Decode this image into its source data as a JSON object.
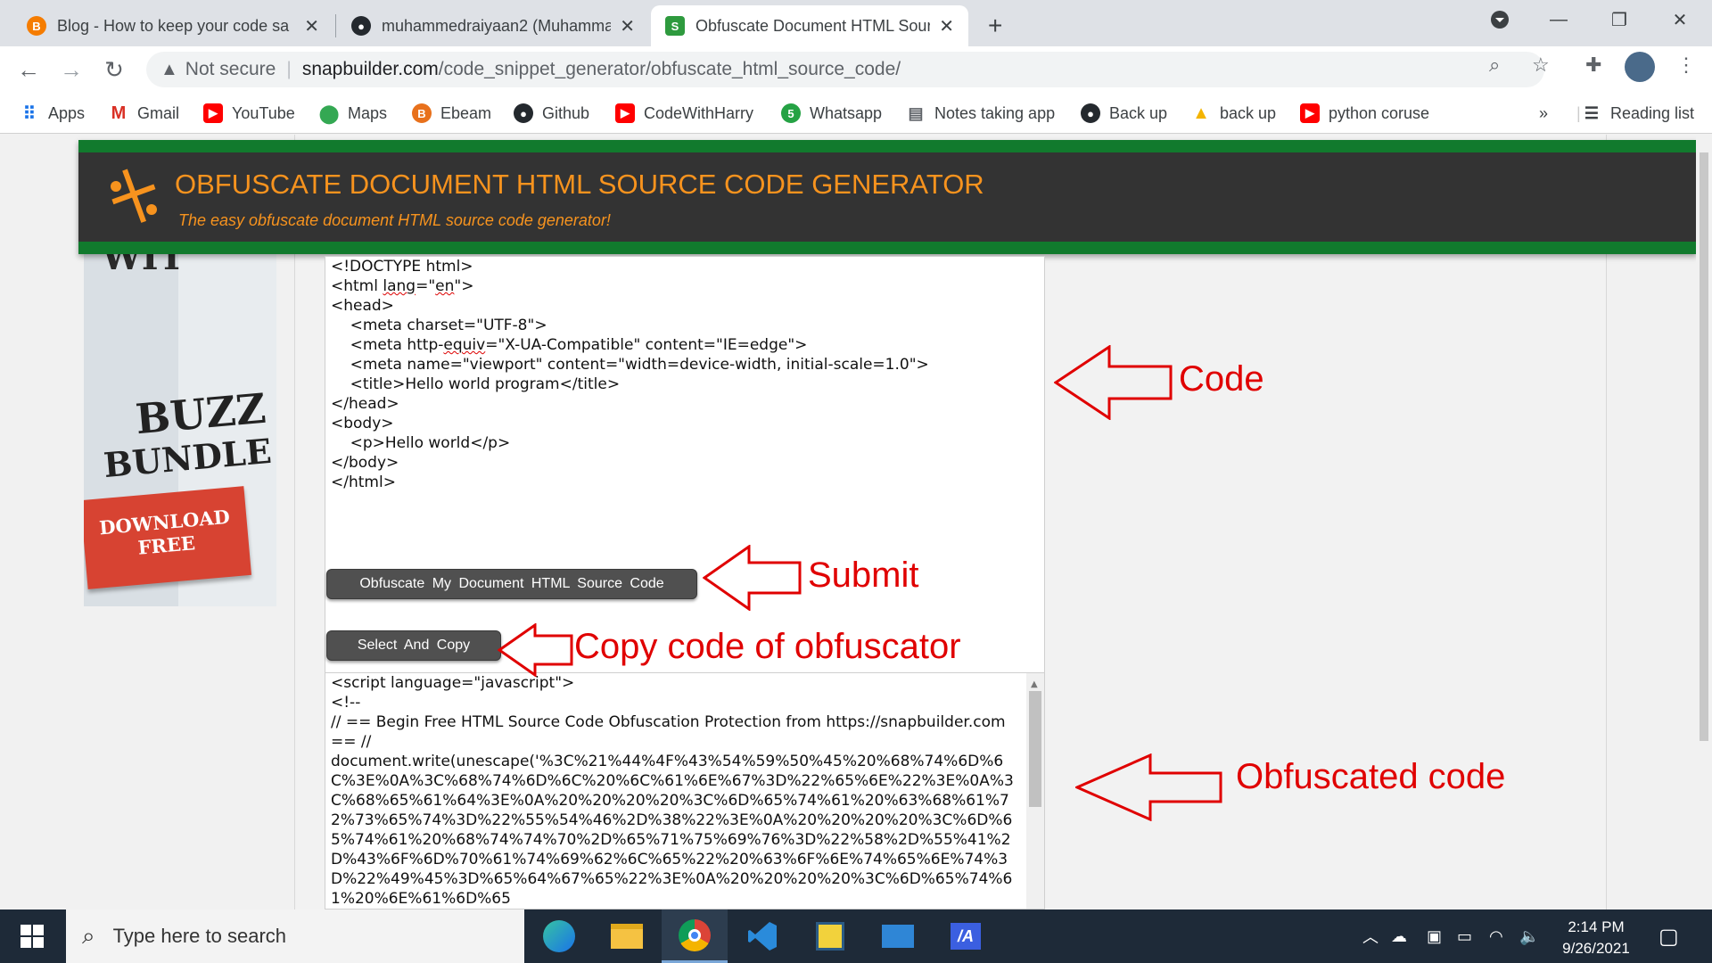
{
  "browser": {
    "tabs": [
      {
        "title": "Blog - How to keep your code sa",
        "favicon": "blogger-icon",
        "active": false
      },
      {
        "title": "muhammedraiyaan2 (Muhamma",
        "favicon": "github-icon",
        "active": false
      },
      {
        "title": "Obfuscate Document HTML Sour",
        "favicon": "snapbuilder-icon",
        "active": true
      }
    ],
    "new_tab_label": "+",
    "address": {
      "security_label": "Not secure",
      "host": "snapbuilder.com",
      "path": "/code_snippet_generator/obfuscate_html_source_code/"
    },
    "bookmarks": [
      {
        "label": "Apps",
        "icon": "apps-grid-icon",
        "color": "#1a73e8"
      },
      {
        "label": "Gmail",
        "icon": "gmail-icon",
        "color": "#d93025"
      },
      {
        "label": "YouTube",
        "icon": "youtube-icon",
        "color": "#ff0000"
      },
      {
        "label": "Maps",
        "icon": "maps-icon",
        "color": "#34a853"
      },
      {
        "label": "Ebeam",
        "icon": "ebeam-icon",
        "color": "#e8711c"
      },
      {
        "label": "Github",
        "icon": "github-icon",
        "color": "#24292e"
      },
      {
        "label": "CodeWithHarry",
        "icon": "youtube-icon",
        "color": "#ff0000"
      },
      {
        "label": "Whatsapp",
        "icon": "whatsapp-icon",
        "color": "#25a244"
      },
      {
        "label": "Notes taking app",
        "icon": "notes-icon",
        "color": "#5f6368"
      },
      {
        "label": "Back up",
        "icon": "github-icon",
        "color": "#24292e"
      },
      {
        "label": "back up",
        "icon": "drive-icon",
        "color": "#f4b400"
      },
      {
        "label": "python coruse",
        "icon": "youtube-icon",
        "color": "#ff0000"
      }
    ],
    "overflow_label": "»",
    "reading_list_label": "Reading list"
  },
  "site": {
    "title": "OBFUSCATE DOCUMENT HTML SOURCE CODE GENERATOR",
    "tagline": "The easy obfuscate document HTML source code generator!",
    "accent": "#f7931e",
    "header_green": "#117a2d"
  },
  "ad": {
    "cut_text": "WIT",
    "line1": "BUZZ",
    "line2": "BUNDLE",
    "cta_line1": "DOWNLOAD",
    "cta_line2": "FREE"
  },
  "input_code": [
    "<!DOCTYPE html>",
    "<html lang=\"en\">",
    "<head>",
    "    <meta charset=\"UTF-8\">",
    "    <meta http-equiv=\"X-UA-Compatible\" content=\"IE=edge\">",
    "    <meta name=\"viewport\" content=\"width=device-width, initial-scale=1.0\">",
    "    <title>Hello world program</title>",
    "</head>",
    "<body>",
    "    <p>Hello world</p>",
    "</body>",
    "</html>"
  ],
  "buttons": {
    "obfuscate": "Obfuscate My Document HTML Source Code",
    "select_copy": "Select And Copy"
  },
  "output_code": [
    "<script language=\"javascript\">",
    "<!--",
    "// == Begin Free HTML Source Code Obfuscation Protection from https://snapbuilder.com == //",
    "document.write(unescape('%3C%21%44%4F%43%54%59%50%45%20%68%74%6D%6C%3E%0A%3C%68%74%6D%6C%20%6C%61%6E%67%3D%22%65%6E%22%3E%0A%3C%68%65%61%64%3E%0A%20%20%20%20%3C%6D%65%74%61%20%63%68%61%72%73%65%74%3D%22%55%54%46%2D%38%22%3E%0A%20%20%20%20%3C%6D%65%74%61%20%68%74%74%70%2D%65%71%75%69%76%3D%22%58%2D%55%41%2D%43%6F%6D%70%61%74%69%62%6C%65%22%20%63%6F%6E%74%65%6E%74%3D%22%49%45%3D%65%64%67%65%22%3E%0A%20%20%20%20%3C%6D%65%74%61%20%6E%61%6D%65"
  ],
  "annotations": {
    "code": "Code",
    "submit": "Submit",
    "copy": "Copy code of obfuscator",
    "obfuscated": "Obfuscated code",
    "color": "#e00000"
  },
  "taskbar": {
    "search_placeholder": "Type here to search",
    "apps": [
      "edge-icon",
      "file-explorer-icon",
      "chrome-icon",
      "vscode-icon",
      "python-idle-icon",
      "mail-icon",
      "app-icon"
    ],
    "time": "2:14 PM",
    "date": "9/26/2021"
  }
}
